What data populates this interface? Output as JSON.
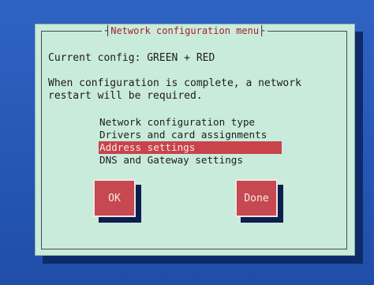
{
  "dialog": {
    "title": "Network configuration menu",
    "current_config_label": "Current config: GREEN + RED",
    "note_line1": "When configuration is complete, a network",
    "note_line2": "restart will be required."
  },
  "menu": {
    "items": [
      {
        "label": "Network configuration type",
        "selected": false
      },
      {
        "label": "Drivers and card assignments",
        "selected": false
      },
      {
        "label": "Address settings",
        "selected": true
      },
      {
        "label": "DNS and Gateway settings",
        "selected": false
      }
    ]
  },
  "buttons": {
    "ok_label": "OK",
    "done_label": "Done"
  },
  "colors": {
    "background": "#2657b6",
    "dialog": "#c9ebdc",
    "highlight": "#c9434a",
    "title_text": "#a3232a"
  }
}
